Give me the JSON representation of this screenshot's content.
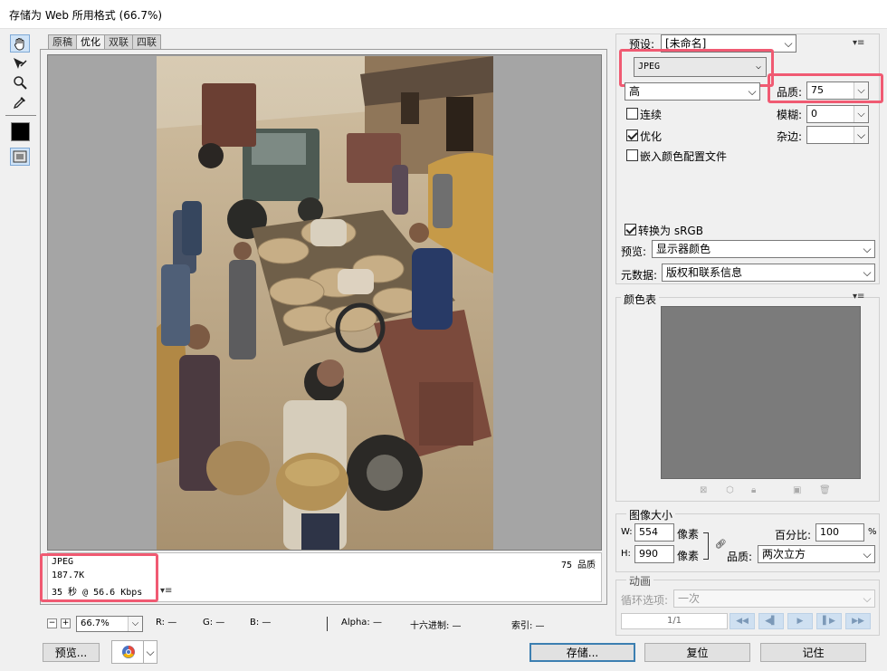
{
  "window": {
    "title": "存储为 Web 所用格式 (66.7%)"
  },
  "tools": [
    "hand-icon",
    "slice-select-icon",
    "zoom-icon",
    "eyedropper-icon",
    "eyedropper-color-swatch",
    "toggle-slices-icon"
  ],
  "tabs": [
    {
      "label": "原稿"
    },
    {
      "label": "优化",
      "active": true
    },
    {
      "label": "双联"
    },
    {
      "label": "四联"
    }
  ],
  "info": {
    "format": "JPEG",
    "size": "187.7K",
    "time": "35 秒 @ 56.6 Kbps",
    "quality_label": "75 品质"
  },
  "status": {
    "zoom": "66.7%",
    "r": "R: —",
    "g": "G: —",
    "b": "B: —",
    "alpha": "Alpha: —",
    "hex": "十六进制: —",
    "index": "索引: —"
  },
  "buttons": {
    "preview": "预览...",
    "save": "存储...",
    "reset": "复位",
    "remember": "记住"
  },
  "settings": {
    "preset_label": "预设:",
    "preset_value": "[未命名]",
    "format": "JPEG",
    "quality_level": "高",
    "quality_label": "品质:",
    "quality_value": "75",
    "progressive_label": "连续",
    "progressive": false,
    "blur_label": "模糊:",
    "blur_value": "0",
    "optimized_label": "优化",
    "optimized": true,
    "matte_label": "杂边:",
    "matte_value": "",
    "embed_profile_label": "嵌入颜色配置文件",
    "embed_profile": false,
    "srgb_label": "转换为 sRGB",
    "srgb": true,
    "preview_label": "预览:",
    "preview_value": "显示器颜色",
    "metadata_label": "元数据:",
    "metadata_value": "版权和联系信息"
  },
  "colortable": {
    "title": "颜色表"
  },
  "imagesize": {
    "title": "图像大小",
    "w_label": "W:",
    "w_value": "554",
    "h_label": "H:",
    "h_value": "990",
    "px_unit": "像素",
    "percent_label": "百分比:",
    "percent_value": "100",
    "percent_unit": "%",
    "quality_label": "品质:",
    "quality_value": "两次立方"
  },
  "animation": {
    "title": "动画",
    "loop_label": "循环选项:",
    "loop_value": "一次",
    "frame": "1/1"
  },
  "colors": {
    "highlight": "#f05a72",
    "accent": "#3c7fb1"
  }
}
